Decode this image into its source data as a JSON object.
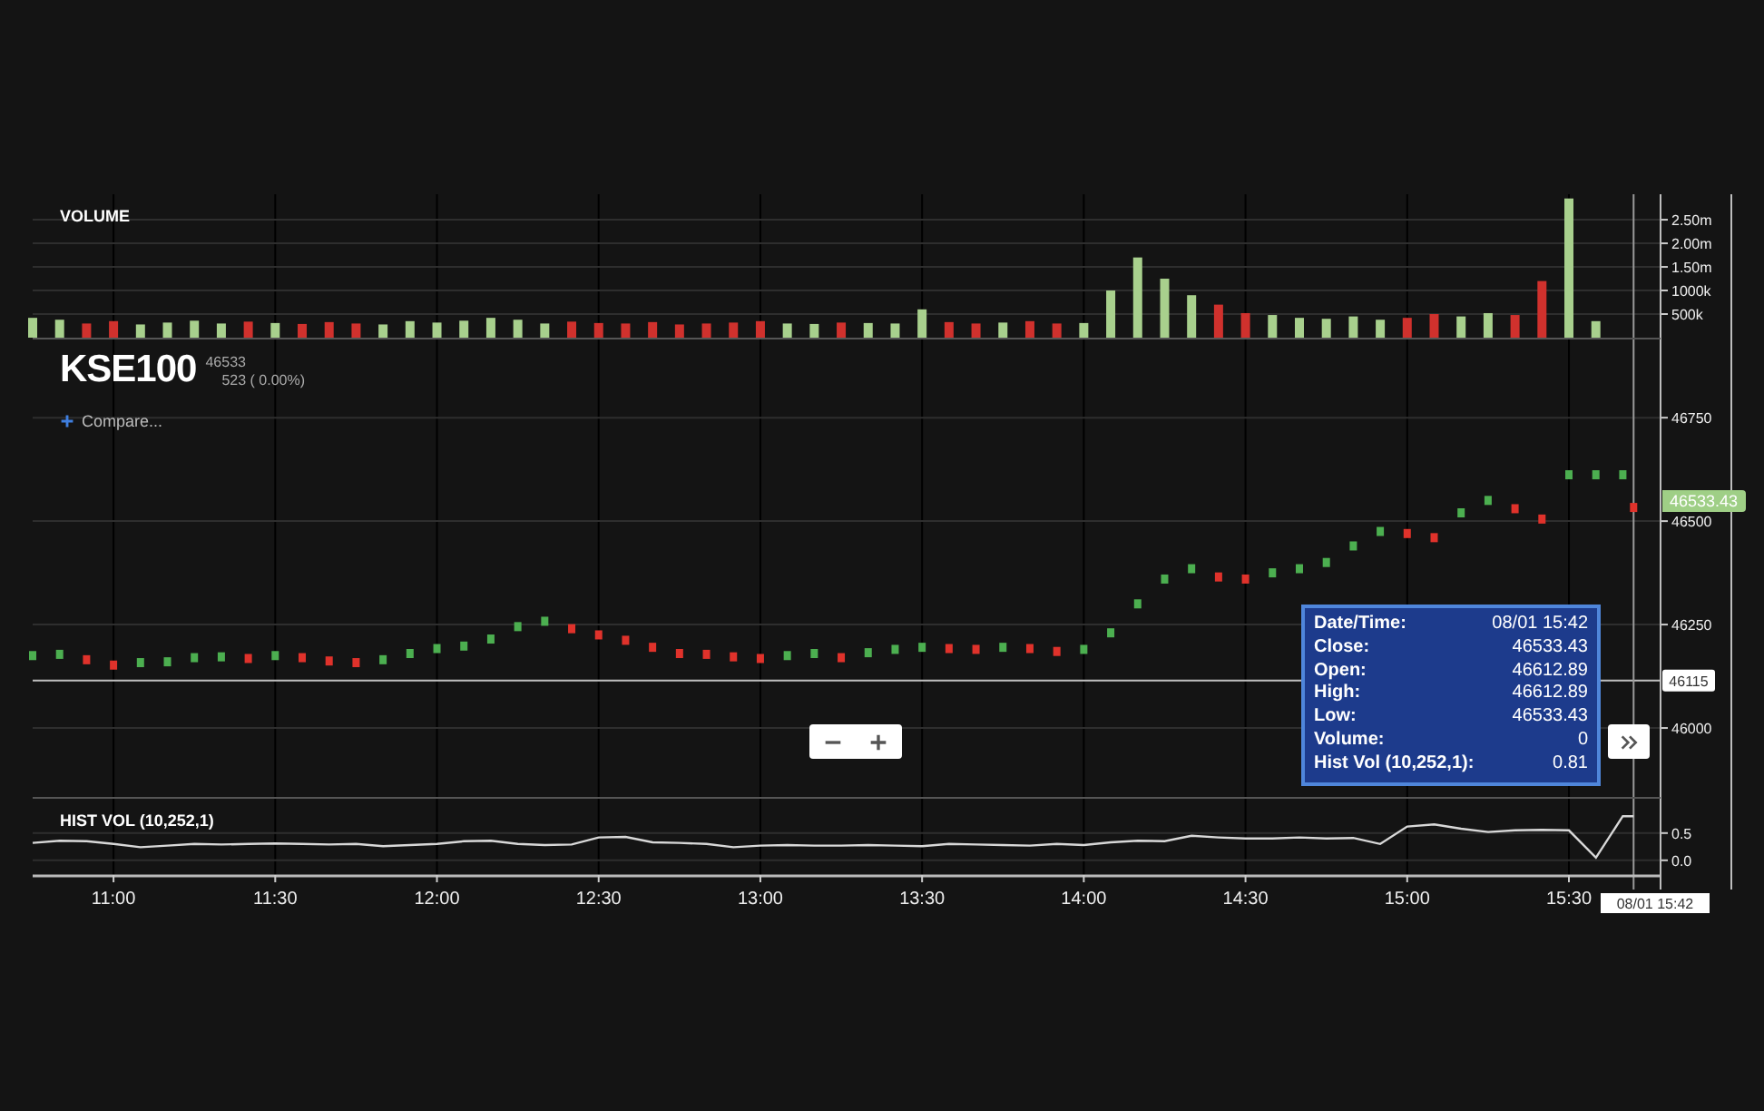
{
  "header": {
    "symbol": "KSE100",
    "price": "46533",
    "change": "523 ( 0.00%)",
    "compare": "Compare..."
  },
  "volume_panel": {
    "chart_data": {
      "type": "bar",
      "title": "VOLUME",
      "grid": true,
      "ref_lines": [
        {
          "axis": "x",
          "value": 942
        }
      ],
      "x": [
        645,
        650,
        655,
        660,
        665,
        670,
        675,
        680,
        685,
        690,
        695,
        700,
        705,
        710,
        715,
        720,
        725,
        730,
        735,
        740,
        745,
        750,
        755,
        760,
        765,
        770,
        775,
        780,
        785,
        790,
        795,
        800,
        805,
        810,
        815,
        820,
        825,
        830,
        835,
        840,
        845,
        850,
        855,
        860,
        865,
        870,
        875,
        880,
        885,
        890,
        895,
        900,
        905,
        910,
        915,
        920,
        925,
        930,
        935
      ],
      "series": [
        {
          "color": "#a8d08d",
          "values": [
            420000,
            380000,
            null,
            null,
            280000,
            320000,
            360000,
            300000,
            null,
            310000,
            null,
            null,
            null,
            280000,
            350000,
            320000,
            360000,
            420000,
            380000,
            300000,
            null,
            null,
            null,
            null,
            null,
            null,
            null,
            null,
            300000,
            290000,
            null,
            310000,
            300000,
            600000,
            null,
            null,
            320000,
            null,
            null,
            310000,
            1000000,
            1700000,
            1250000,
            900000,
            null,
            null,
            480000,
            420000,
            400000,
            450000,
            380000,
            null,
            null,
            450000,
            520000,
            null,
            null,
            2950000,
            350000
          ]
        },
        {
          "color": "#d0312d",
          "values": [
            null,
            null,
            300000,
            350000,
            null,
            null,
            null,
            null,
            340000,
            null,
            290000,
            330000,
            300000,
            null,
            null,
            null,
            null,
            null,
            null,
            null,
            340000,
            310000,
            300000,
            330000,
            280000,
            300000,
            320000,
            350000,
            null,
            null,
            320000,
            null,
            null,
            null,
            330000,
            300000,
            null,
            350000,
            300000,
            null,
            null,
            null,
            null,
            null,
            700000,
            520000,
            null,
            null,
            null,
            null,
            null,
            420000,
            500000,
            null,
            null,
            480000,
            1200000,
            null,
            null
          ]
        }
      ],
      "xlim": [
        645,
        947
      ],
      "ylim": [
        0,
        3040000
      ],
      "yticks": [
        {
          "value": 500000,
          "label": "500k"
        },
        {
          "value": 1000000,
          "label": "1000k"
        },
        {
          "value": 1500000,
          "label": "1.50m"
        },
        {
          "value": 2000000,
          "label": "2.00m"
        },
        {
          "value": 2500000,
          "label": "2.50m"
        }
      ]
    }
  },
  "price_panel": {
    "chart_data": {
      "type": "scatter",
      "grid": true,
      "x": [
        645,
        650,
        655,
        660,
        665,
        670,
        675,
        680,
        685,
        690,
        695,
        700,
        705,
        710,
        715,
        720,
        725,
        730,
        735,
        740,
        745,
        750,
        755,
        760,
        765,
        770,
        775,
        780,
        785,
        790,
        795,
        800,
        805,
        810,
        815,
        820,
        825,
        830,
        835,
        840,
        845,
        850,
        855,
        860,
        865,
        870,
        875,
        880,
        885,
        890,
        895,
        900,
        905,
        910,
        915,
        920,
        925,
        930,
        935,
        940,
        942
      ],
      "series": [
        {
          "color": "#4caf50",
          "values": [
            46175,
            46178,
            null,
            null,
            46158,
            46160,
            46170,
            46172,
            null,
            46175,
            null,
            null,
            null,
            46165,
            46180,
            46192,
            46198,
            46215,
            46245,
            46258,
            null,
            null,
            null,
            null,
            null,
            null,
            null,
            null,
            46175,
            46180,
            null,
            46182,
            46190,
            46195,
            null,
            null,
            46195,
            null,
            null,
            46190,
            46230,
            46300,
            46360,
            46385,
            null,
            null,
            46375,
            46385,
            46400,
            46440,
            46475,
            null,
            null,
            46520,
            46550,
            null,
            null,
            46612,
            46612,
            46612,
            null
          ]
        },
        {
          "color": "#e0322b",
          "values": [
            null,
            null,
            46165,
            46152,
            null,
            null,
            null,
            null,
            46168,
            null,
            46170,
            46162,
            46158,
            null,
            null,
            null,
            null,
            null,
            null,
            null,
            46240,
            46225,
            46212,
            46195,
            46180,
            46178,
            46172,
            46168,
            null,
            null,
            46170,
            null,
            null,
            null,
            46192,
            46190,
            null,
            46192,
            46185,
            null,
            null,
            null,
            null,
            null,
            46365,
            46360,
            null,
            null,
            null,
            null,
            null,
            46470,
            46460,
            null,
            null,
            46530,
            46505,
            null,
            null,
            null,
            46533
          ]
        }
      ],
      "xlim": [
        645,
        947
      ],
      "ylim": [
        45829,
        46939
      ],
      "yticks": [
        46000,
        46250,
        46500,
        46750
      ],
      "ref_lines": [
        {
          "axis": "y",
          "value": 46115,
          "label": "46115"
        },
        {
          "axis": "x",
          "value": 942
        }
      ]
    },
    "last_price_tag": "46533.43"
  },
  "tooltip": {
    "rows": [
      {
        "label": "Date/Time:",
        "value": "08/01 15:42"
      },
      {
        "label": "Close:",
        "value": "46533.43"
      },
      {
        "label": "Open:",
        "value": "46612.89"
      },
      {
        "label": "High:",
        "value": "46612.89"
      },
      {
        "label": "Low:",
        "value": "46533.43"
      },
      {
        "label": "Volume:",
        "value": "0"
      },
      {
        "label": "Hist Vol (10,252,1):",
        "value": "0.81"
      }
    ]
  },
  "hist_vol_panel": {
    "chart_data": {
      "type": "line",
      "title": "HIST VOL (10,252,1)",
      "grid": true,
      "ref_lines": [
        {
          "axis": "x",
          "value": 942
        }
      ],
      "x": [
        645,
        650,
        655,
        660,
        665,
        670,
        675,
        680,
        685,
        690,
        695,
        700,
        705,
        710,
        715,
        720,
        725,
        730,
        735,
        740,
        745,
        750,
        755,
        760,
        765,
        770,
        775,
        780,
        785,
        790,
        795,
        800,
        805,
        810,
        815,
        820,
        825,
        830,
        835,
        840,
        845,
        850,
        855,
        860,
        865,
        870,
        875,
        880,
        885,
        890,
        895,
        900,
        905,
        910,
        915,
        920,
        925,
        930,
        935,
        940,
        942
      ],
      "series": [
        {
          "color": "#d8d8d8",
          "values": [
            0.32,
            0.36,
            0.35,
            0.3,
            0.24,
            0.27,
            0.3,
            0.29,
            0.3,
            0.31,
            0.3,
            0.29,
            0.3,
            0.26,
            0.28,
            0.3,
            0.35,
            0.36,
            0.3,
            0.28,
            0.29,
            0.42,
            0.43,
            0.33,
            0.32,
            0.3,
            0.24,
            0.27,
            0.28,
            0.27,
            0.27,
            0.28,
            0.27,
            0.26,
            0.3,
            0.29,
            0.28,
            0.27,
            0.3,
            0.28,
            0.33,
            0.36,
            0.35,
            0.45,
            0.42,
            0.4,
            0.4,
            0.42,
            0.4,
            0.41,
            0.3,
            0.62,
            0.66,
            0.58,
            0.52,
            0.55,
            0.56,
            0.55,
            0.05,
            0.81,
            0.81
          ]
        }
      ],
      "xlim": [
        645,
        947
      ],
      "ylim": [
        -0.27,
        1.13
      ],
      "yticks": [
        {
          "value": 0,
          "label": "0.0"
        },
        {
          "value": 0.5,
          "label": "0.5"
        }
      ],
      "xticks": [
        {
          "value": 660,
          "label": "11:00"
        },
        {
          "value": 690,
          "label": "11:30"
        },
        {
          "value": 720,
          "label": "12:00"
        },
        {
          "value": 750,
          "label": "12:30"
        },
        {
          "value": 780,
          "label": "13:00"
        },
        {
          "value": 810,
          "label": "13:30"
        },
        {
          "value": 840,
          "label": "14:00"
        },
        {
          "value": 870,
          "label": "14:30"
        },
        {
          "value": 900,
          "label": "15:00"
        },
        {
          "value": 930,
          "label": "15:30"
        }
      ]
    }
  },
  "crosshair_time_tag": "08/01 15:42"
}
